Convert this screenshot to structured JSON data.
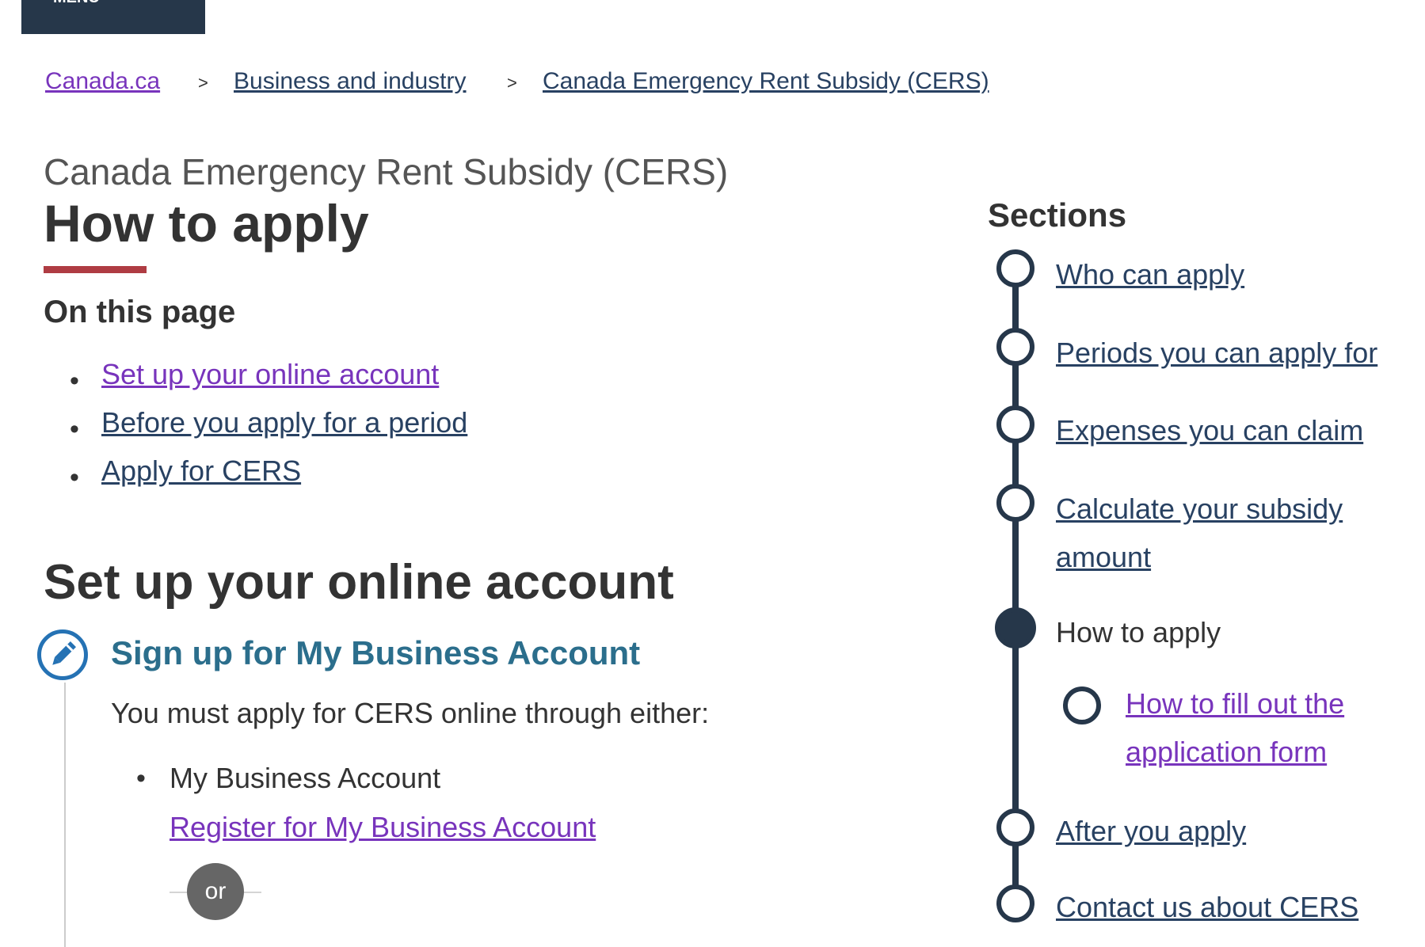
{
  "header": {
    "topbar_text": "MENU"
  },
  "breadcrumb": {
    "separator": ">",
    "items": [
      "Canada.ca",
      "Business and industry",
      "Canada Emergency Rent Subsidy (CERS)"
    ]
  },
  "page": {
    "subtitle": "Canada Emergency Rent Subsidy (CERS)",
    "title": "How to apply"
  },
  "on_this_page": {
    "title": "On this page",
    "bullet": "•",
    "links": [
      "Set up your online account",
      "Before you apply for a period",
      "Apply for CERS"
    ]
  },
  "section": {
    "title": "Set up your online account",
    "step": {
      "icon": "pencil-icon",
      "title": "Sign up for My Business Account",
      "text": "You must apply for CERS online through either:",
      "bullet": "•",
      "item": "My Business Account",
      "link": "Register for My Business Account",
      "or": "or"
    }
  },
  "sidebar": {
    "title": "Sections",
    "items": [
      {
        "line1": "Who can apply"
      },
      {
        "line1": "Periods you can apply for"
      },
      {
        "line1": "Expenses you can claim"
      },
      {
        "line1": "Calculate your subsidy",
        "line2": "amount"
      },
      {
        "line1": "How to apply"
      },
      {
        "line1": "How to fill out the",
        "line2": "application form"
      },
      {
        "line1": "After you apply"
      },
      {
        "line1": "Contact us about CERS"
      }
    ]
  },
  "colors": {
    "link": "#284162",
    "visited_link": "#7834bc",
    "accent_red": "#af3c43",
    "nav_dark": "#26374a",
    "step_blue": "#2572b4"
  }
}
